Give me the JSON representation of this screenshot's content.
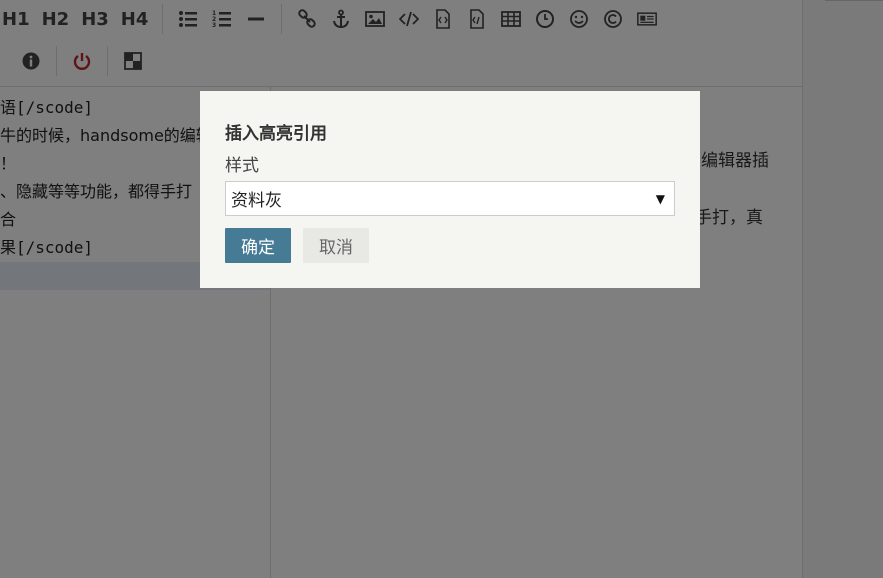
{
  "toolbar": {
    "headings": [
      "H1",
      "H2",
      "H3",
      "H4"
    ],
    "row1_icons": [
      "list-ul-icon",
      "list-ol-icon",
      "horizontal-rule-icon",
      "link-icon",
      "anchor-icon",
      "image-icon",
      "code-icon",
      "code-file-icon",
      "code-file-alt-icon",
      "table-icon",
      "clock-icon",
      "smile-icon",
      "copyright-icon",
      "article-icon"
    ],
    "row2_icons": [
      "info-icon",
      "power-icon",
      "grid-toggle-icon"
    ],
    "power_color": "#c1272d"
  },
  "editor": {
    "lines": [
      "语[/scode]",
      "牛的时候，handsome的编辑",
      "！",
      "、隐藏等等功能，都得手打",
      "合",
      "果[/scode]"
    ]
  },
  "preview": {
    "line1": "编辑器插",
    "line2": "手打，真"
  },
  "dialog": {
    "title": "插入高亮引用",
    "style_label": "样式",
    "style_value": "资料灰",
    "ok_label": "确定",
    "cancel_label": "取消"
  },
  "colors": {
    "primary": "#467b96",
    "overlay": "rgba(0,0,0,0.5)",
    "dialog_bg": "#f5f5f2"
  }
}
